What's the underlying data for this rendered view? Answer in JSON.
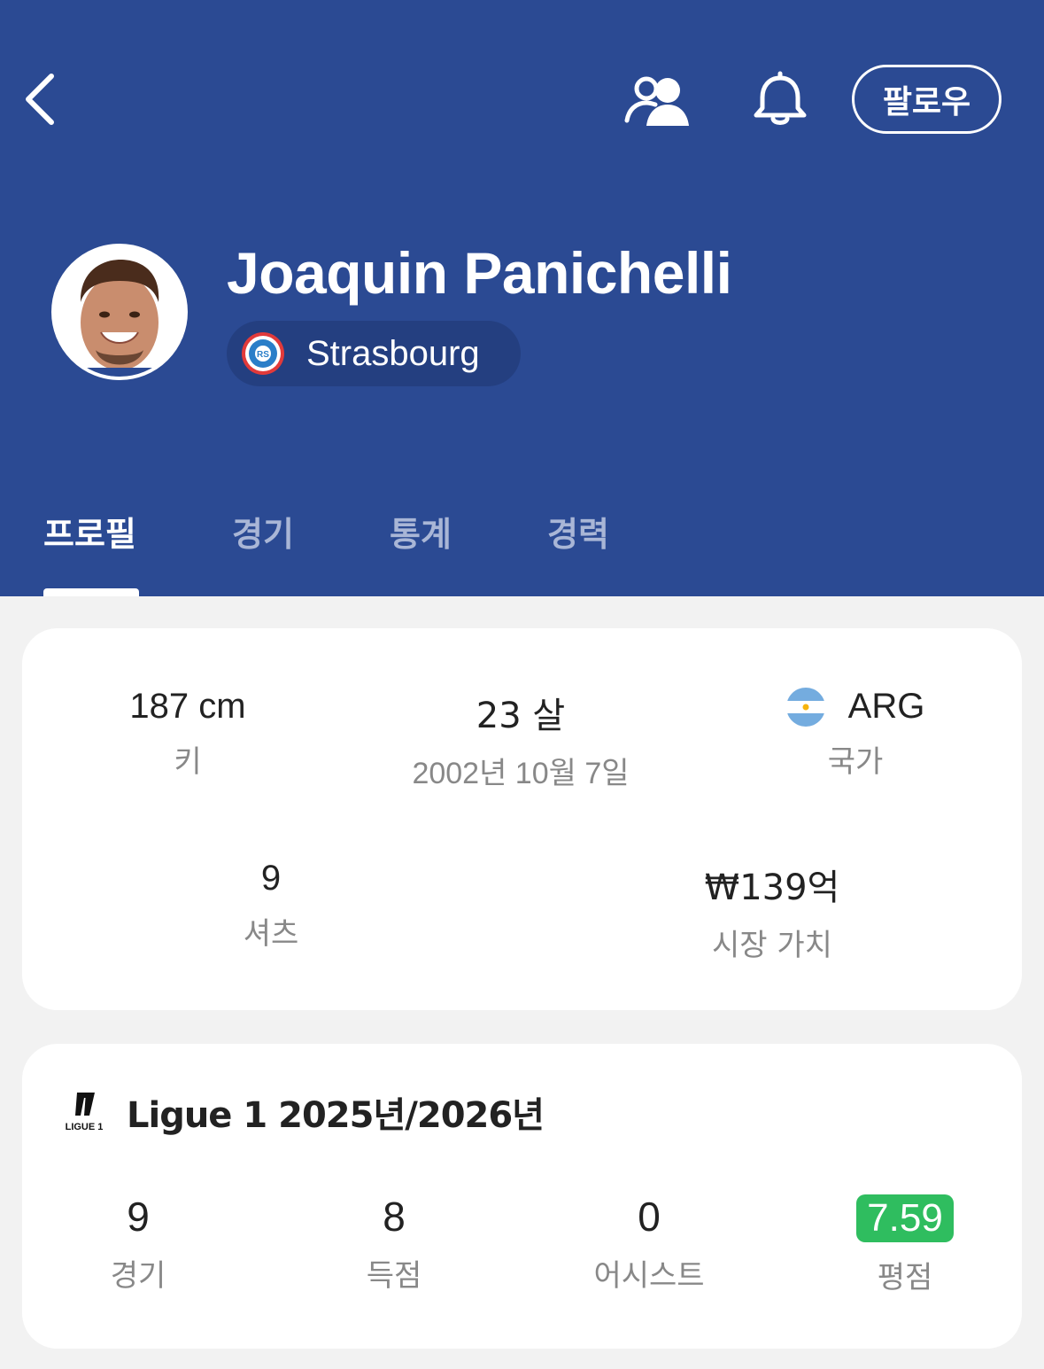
{
  "header": {
    "follow_label": "팔로우",
    "icons": {
      "back": "chevron-left-icon",
      "people": "people-icon",
      "bell": "bell-icon"
    },
    "bg_color": "#2b4a93"
  },
  "player": {
    "name": "Joaquin Panichelli",
    "team": "Strasbourg"
  },
  "tabs": [
    {
      "label": "프로필",
      "active": true
    },
    {
      "label": "경기",
      "active": false
    },
    {
      "label": "통계",
      "active": false
    },
    {
      "label": "경력",
      "active": false
    }
  ],
  "profile": {
    "height": {
      "value": "187 cm",
      "label": "키"
    },
    "age": {
      "value": "23 살",
      "label": "2002년 10월 7일"
    },
    "nation": {
      "value": "ARG",
      "label": "국가"
    },
    "shirt": {
      "value": "9",
      "label": "셔츠"
    },
    "market_value": {
      "value": "₩139억",
      "label": "시장 가치"
    }
  },
  "season": {
    "title": "Ligue 1 2025년/2026년",
    "logo_text": "LIGUE 1",
    "stats": {
      "matches": {
        "value": "9",
        "label": "경기"
      },
      "goals": {
        "value": "8",
        "label": "득점"
      },
      "assists": {
        "value": "0",
        "label": "어시스트"
      },
      "rating": {
        "value": "7.59",
        "label": "평점",
        "color": "#2fbd5f"
      }
    }
  }
}
